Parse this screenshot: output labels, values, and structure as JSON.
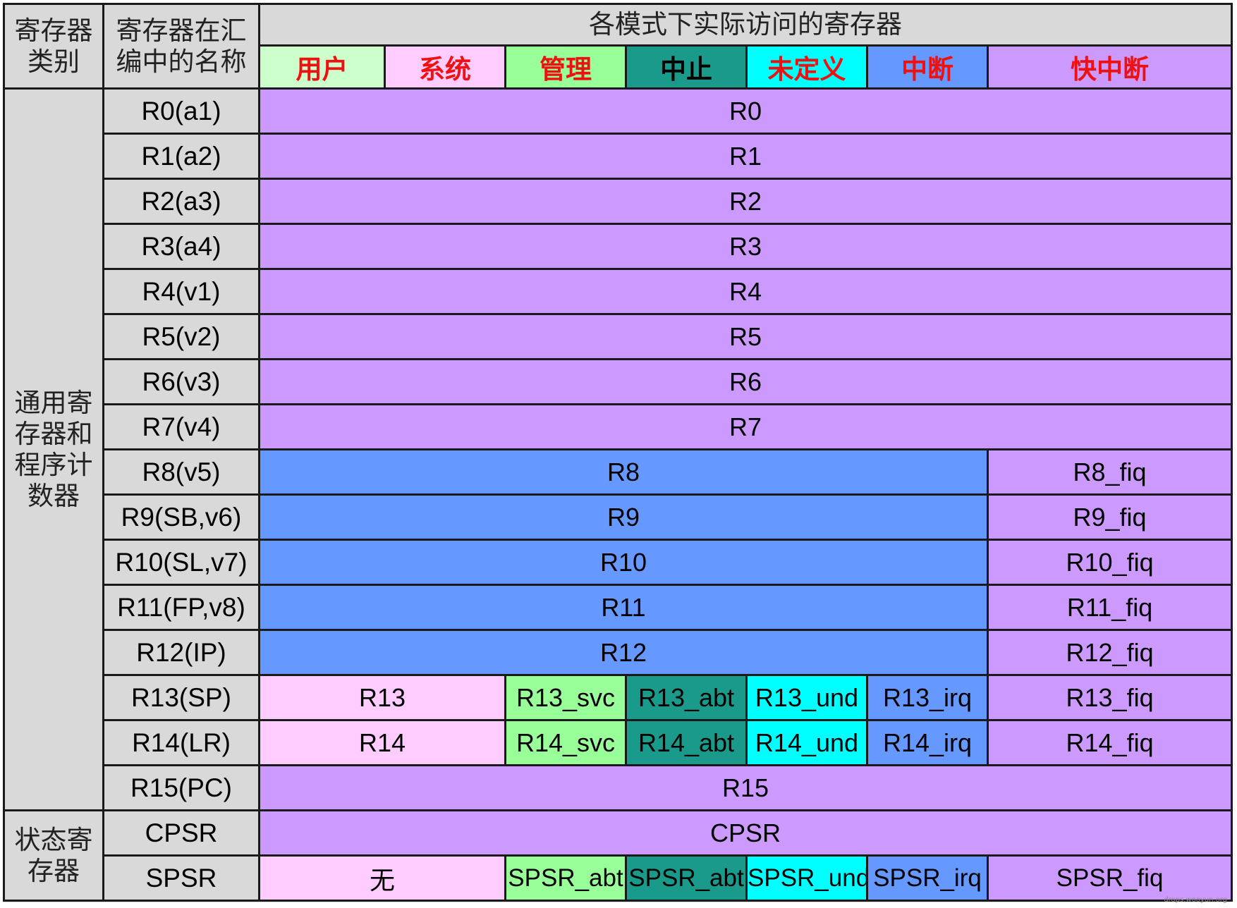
{
  "header": {
    "col1": "寄存器类别",
    "col2": "寄存器在汇编中的名称",
    "modes_title": "各模式下实际访问的寄存器",
    "modes": [
      "用户",
      "系统",
      "管理",
      "中止",
      "未定义",
      "中断",
      "快中断"
    ]
  },
  "categories": {
    "general": "通用寄存器和程序计数器",
    "status": "状态寄存器"
  },
  "colors": {
    "user": "#ffccff",
    "system": "#ffccff",
    "svc": "#99ff99",
    "abt": "#1a9a8a",
    "und": "#00ffff",
    "irq": "#6699ff",
    "fiq": "#cc99ff",
    "shared": "#cc99ff",
    "banked_8_12": "#6699ff",
    "user_header": "#ccffcc",
    "system_header": "#ffccff"
  },
  "rows": {
    "r0": {
      "name": "R0(a1)",
      "all": "R0"
    },
    "r1": {
      "name": "R1(a2)",
      "all": "R1"
    },
    "r2": {
      "name": "R2(a3)",
      "all": "R2"
    },
    "r3": {
      "name": "R3(a4)",
      "all": "R3"
    },
    "r4": {
      "name": "R4(v1)",
      "all": "R4"
    },
    "r5": {
      "name": "R5(v2)",
      "all": "R5"
    },
    "r6": {
      "name": "R6(v3)",
      "all": "R6"
    },
    "r7": {
      "name": "R7(v4)",
      "all": "R7"
    },
    "r8": {
      "name": "R8(v5)",
      "common": "R8",
      "fiq": "R8_fiq"
    },
    "r9": {
      "name": "R9(SB,v6)",
      "common": "R9",
      "fiq": "R9_fiq"
    },
    "r10": {
      "name": "R10(SL,v7)",
      "common": "R10",
      "fiq": "R10_fiq"
    },
    "r11": {
      "name": "R11(FP,v8)",
      "common": "R11",
      "fiq": "R11_fiq"
    },
    "r12": {
      "name": "R12(IP)",
      "common": "R12",
      "fiq": "R12_fiq"
    },
    "r13": {
      "name": "R13(SP)",
      "usr_sys": "R13",
      "svc": "R13_svc",
      "abt": "R13_abt",
      "und": "R13_und",
      "irq": "R13_irq",
      "fiq": "R13_fiq"
    },
    "r14": {
      "name": "R14(LR)",
      "usr_sys": "R14",
      "svc": "R14_svc",
      "abt": "R14_abt",
      "und": "R14_und",
      "irq": "R14_irq",
      "fiq": "R14_fiq"
    },
    "r15": {
      "name": "R15(PC)",
      "all": "R15"
    },
    "cpsr": {
      "name": "CPSR",
      "all": "CPSR"
    },
    "spsr": {
      "name": "SPSR",
      "usr_sys": "无",
      "svc": "SPSR_abt",
      "abt": "SPSR_abt",
      "und": "SPSR_und",
      "irq": "SPSR_irq",
      "fiq": "SPSR_fiq"
    }
  },
  "watermark": "drops.wooyun.org"
}
